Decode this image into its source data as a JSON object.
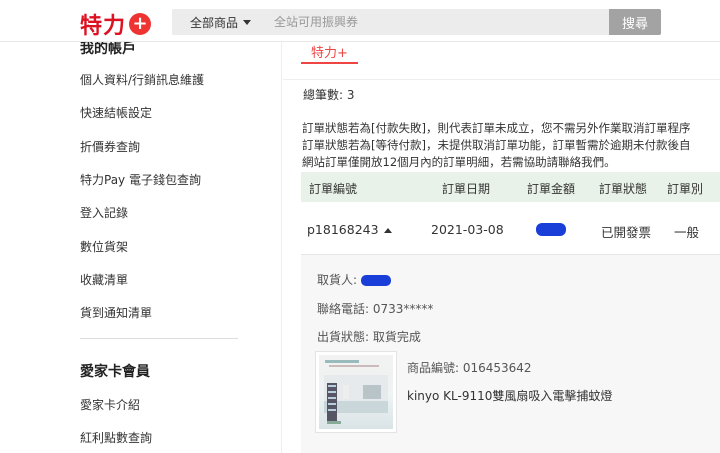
{
  "header": {
    "logo_text": "特力",
    "logo_plus": "+",
    "category_label": "全部商品",
    "search_placeholder": "全站可用振興券",
    "search_button": "搜尋"
  },
  "sidebar": {
    "section_title": "我的帳戶",
    "items": [
      "個人資料/行銷訊息維護",
      "快速結帳設定",
      "折價券查詢",
      "特力Pay 電子錢包查詢",
      "登入記錄",
      "數位貨架",
      "收藏清單",
      "貨到通知清單"
    ],
    "section2_title": "愛家卡會員",
    "items2": [
      "愛家卡介紹",
      "紅利點數查詢"
    ]
  },
  "main": {
    "tab_label": "特力+",
    "total_text": "總筆數: 3",
    "notice_lines": [
      "訂單狀態若為[付款失敗]，則代表訂單未成立，您不需另外作業取消訂單程序",
      "訂單狀態若為[等待付款]，未提供取消訂單功能，訂單暫需於逾期未付款後自",
      "網站訂單僅開放12個月內的訂單明細，若需協助請聯絡我們。"
    ],
    "table_headers": [
      "訂單編號",
      "訂單日期",
      "訂單金額",
      "訂單狀態",
      "訂單別"
    ],
    "order": {
      "id": "p18168243",
      "date": "2021-03-08",
      "status": "已開發票",
      "type": "一般"
    },
    "detail": {
      "consignee_label": "取貨人:",
      "phone": "聯絡電話: 0733*****",
      "shipping_status": "出貨狀態: 取貨完成",
      "product_code": "商品編號: 016453642",
      "product_name": "kinyo KL-9110雙風扇吸入電擊捕蚊燈"
    }
  },
  "colors": {
    "brand": "#dd1122",
    "accent": "#e44444",
    "table_header_bg": "#e8f2e8",
    "mask": "#1a3fd8"
  }
}
